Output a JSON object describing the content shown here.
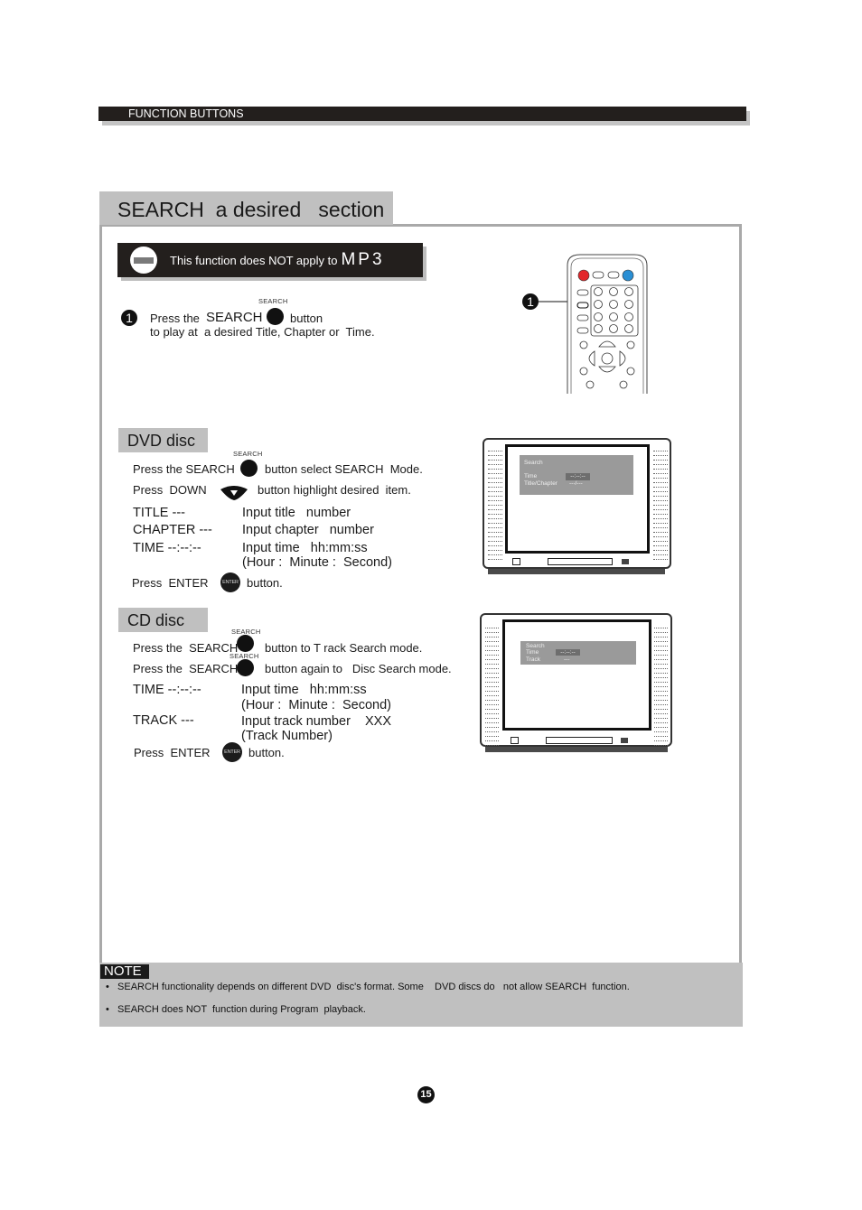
{
  "header": {
    "title": "FUNCTION BUTTONS"
  },
  "section": {
    "title": "SEARCH  a desired   section"
  },
  "warning": {
    "text": "This function does NOT apply to",
    "format": "MP3",
    "icon": "no-entry-icon"
  },
  "intro": {
    "step": "1",
    "button_caption": "SEARCH",
    "line1_pre": "Press the ",
    "line1_key": "SEARCH",
    "line1_post": "button",
    "line2": "to play at  a desired Title, Chapter or  Time."
  },
  "remote": {
    "callout": "1",
    "highlight_button": "SEARCH",
    "colors": {
      "power": "#e2262a",
      "eject": "#2a8fd4"
    }
  },
  "dvd": {
    "tab": "DVD disc",
    "button_caption": "SEARCH",
    "step1_pre": "Press the SEARCH",
    "step1_post": "button select SEARCH  Mode.",
    "step2_pre": "Press  DOWN",
    "step2_post": "button highlight desired  item.",
    "rows": [
      {
        "label": "TITLE ---",
        "desc": "Input title   number"
      },
      {
        "label": "CHAPTER ---",
        "desc": "Input chapter   number"
      },
      {
        "label": "TIME --:--:--",
        "desc": "Input time   hh:mm:ss",
        "desc2": "(Hour :  Minute :  Second)"
      }
    ],
    "enter_pre": "Press  ENTER",
    "enter_btn": "ENTER",
    "enter_post": "button.",
    "osd": {
      "title": "Search",
      "row1_label": "Time",
      "row1_value": "--:--:--",
      "row2_label": "Title/Chapter",
      "row2_value": "---/---"
    }
  },
  "cd": {
    "tab": "CD disc",
    "button_caption": "SEARCH",
    "step1_pre": "Press the  SEARCH",
    "step1_post": "button to T rack Search mode.",
    "step2_pre": "Press the  SEARCH",
    "step2_post": "button again to   Disc Search mode.",
    "rows": [
      {
        "label": "TIME --:--:--",
        "desc": "Input time   hh:mm:ss",
        "desc2": "(Hour :  Minute :  Second)"
      },
      {
        "label": "TRACK ---",
        "desc": "Input track number    XXX",
        "desc2": "(Track Number)"
      }
    ],
    "enter_pre": "Press  ENTER",
    "enter_btn": "ENTER",
    "enter_post": "button.",
    "osd": {
      "title": "Search",
      "row1_label": "Time",
      "row1_value": "--:--:--",
      "row2_label": "Track",
      "row2_value": "---"
    }
  },
  "note": {
    "label": "NOTE",
    "items": [
      "SEARCH functionality depends on different DVD  disc's format. Some    DVD discs do   not allow SEARCH  function.",
      "SEARCH does NOT  function during Program  playback."
    ]
  },
  "page_number": "15"
}
